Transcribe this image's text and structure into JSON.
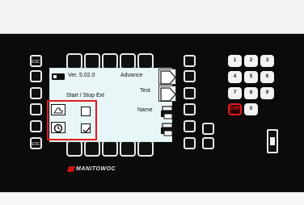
{
  "screen": {
    "version_label": "Ver. 5.02.0",
    "title": "Start / Stop Ext",
    "buttons": {
      "advance": "Advance",
      "test": "Test",
      "name": "Name"
    }
  },
  "left_keys": {
    "top_left": "ESC",
    "bottom_left": "ESC"
  },
  "right_keys": {
    "top": "",
    "bottom": ""
  },
  "keypad": {
    "keys": [
      "1",
      "2",
      "3",
      "4",
      "5",
      "6",
      "7",
      "8",
      "9",
      "ERR",
      "0"
    ]
  },
  "brand": {
    "text": "MANITOWOC"
  },
  "colors": {
    "device_background": "#0b0b0b",
    "screen_background": "#e8f6f8",
    "highlight": "#e21b1b"
  },
  "icons": {
    "version": "device-icon",
    "hand": "hand-icon",
    "clock": "clock-icon",
    "print": "print-icon"
  }
}
